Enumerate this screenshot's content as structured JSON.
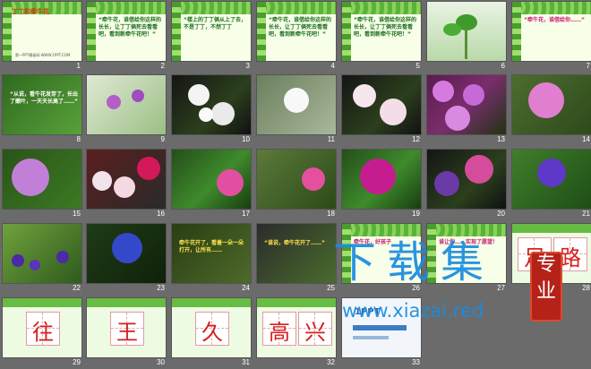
{
  "slides": [
    {
      "n": "1",
      "title": "丁丁和牵牛花",
      "footer": "第一PPT模板网-WWW.1PPT.COM"
    },
    {
      "n": "2",
      "text": "“牵牛花，谁借给你这样的长长，让丁丁俩死去看看吧，看到新牵牛花吧！”"
    },
    {
      "n": "3",
      "text": "“楼上的丁丁俩从上了去，不是丁丁，不然丁丁"
    },
    {
      "n": "4",
      "text": "“牵牛花，谁借给你这样的长长，让丁丁俩死去看看吧，看到新牵牛花吧！”"
    },
    {
      "n": "5",
      "text": "“牵牛花，谁借给你这样的长长，让丁丁俩死去看看吧，看到新牵牛花吧！”"
    },
    {
      "n": "6"
    },
    {
      "n": "7",
      "text": "“牵牛花，谁借给你……”"
    },
    {
      "n": "8",
      "text": "“从说，看牛花发芽了，长出了嫩叶，一天天长高了……”"
    },
    {
      "n": "9"
    },
    {
      "n": "10"
    },
    {
      "n": "11"
    },
    {
      "n": "12"
    },
    {
      "n": "13"
    },
    {
      "n": "14"
    },
    {
      "n": "15"
    },
    {
      "n": "16"
    },
    {
      "n": "17"
    },
    {
      "n": "18"
    },
    {
      "n": "19"
    },
    {
      "n": "20"
    },
    {
      "n": "21"
    },
    {
      "n": "22"
    },
    {
      "n": "23"
    },
    {
      "n": "24",
      "text": "牵牛花开了，看着一朵一朵打开，让所有……"
    },
    {
      "n": "25",
      "text": "“谁说，牵牛花开了……”"
    },
    {
      "n": "26",
      "text": "牵牛花，好孩子"
    },
    {
      "n": "27",
      "text": "谁让你……实现了愿望！"
    },
    {
      "n": "28",
      "chars": [
        "足",
        "路"
      ]
    },
    {
      "n": "29",
      "chars": [
        "往"
      ]
    },
    {
      "n": "30",
      "chars": [
        "王"
      ]
    },
    {
      "n": "31",
      "chars": [
        "久"
      ]
    },
    {
      "n": "32",
      "chars": [
        "高",
        "兴"
      ]
    },
    {
      "n": "33",
      "text": "1PPT"
    }
  ],
  "watermark": {
    "title": "下载集",
    "url": "www.xiazai.red",
    "seal": [
      "专",
      "业"
    ]
  }
}
